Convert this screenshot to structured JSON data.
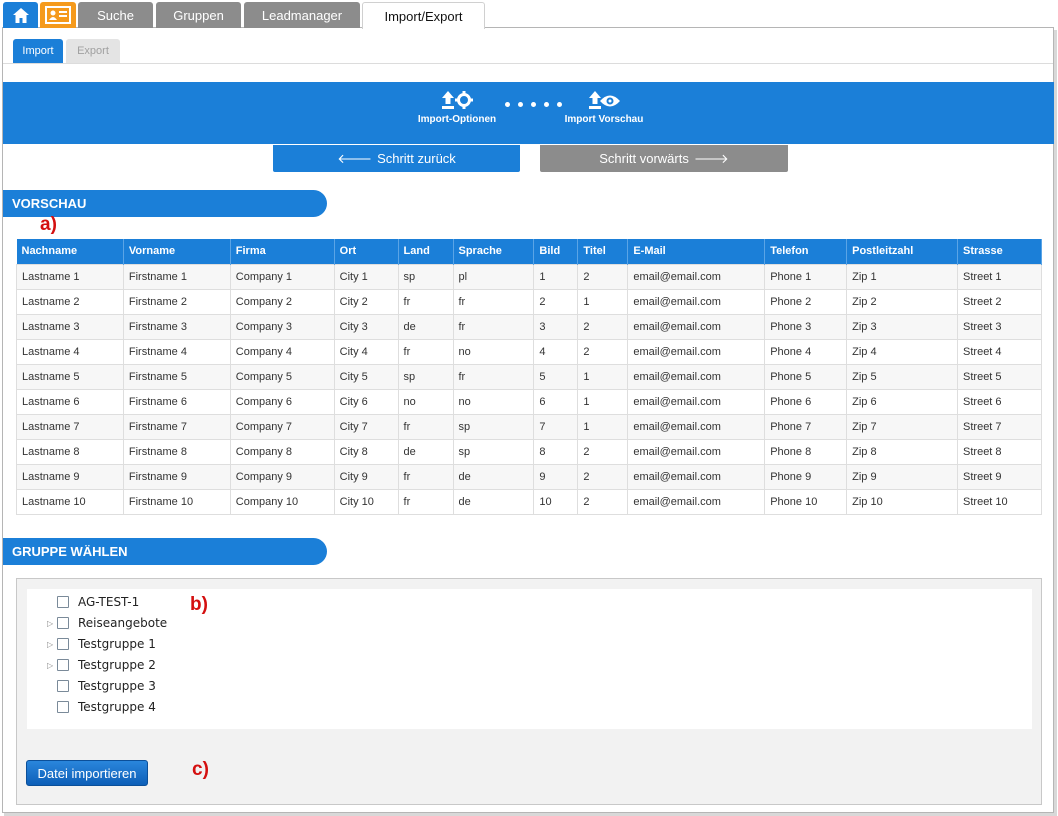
{
  "top_tabs": [
    {
      "label": "Suche",
      "active": false
    },
    {
      "label": "Gruppen",
      "active": false
    },
    {
      "label": "Leadmanager",
      "active": false
    },
    {
      "label": "Import/Export",
      "active": true
    }
  ],
  "sub_tabs": {
    "import": "Import",
    "export": "Export"
  },
  "steps": {
    "import_options": "Import-Optionen",
    "import_preview": "Import Vorschau"
  },
  "nav": {
    "back": "Schritt zurück",
    "forward": "Schritt vorwärts"
  },
  "preview": {
    "title": "VORSCHAU",
    "columns": [
      "Nachname",
      "Vorname",
      "Firma",
      "Ort",
      "Land",
      "Sprache",
      "Bild",
      "Titel",
      "E-Mail",
      "Telefon",
      "Postleitzahl",
      "Strasse"
    ],
    "rows": [
      [
        "Lastname 1",
        "Firstname 1",
        "Company 1",
        "City 1",
        "sp",
        "pl",
        "1",
        "2",
        "email@email.com",
        "Phone 1",
        "Zip 1",
        "Street 1"
      ],
      [
        "Lastname 2",
        "Firstname 2",
        "Company 2",
        "City 2",
        "fr",
        "fr",
        "2",
        "1",
        "email@email.com",
        "Phone 2",
        "Zip 2",
        "Street 2"
      ],
      [
        "Lastname 3",
        "Firstname 3",
        "Company 3",
        "City 3",
        "de",
        "fr",
        "3",
        "2",
        "email@email.com",
        "Phone 3",
        "Zip 3",
        "Street 3"
      ],
      [
        "Lastname 4",
        "Firstname 4",
        "Company 4",
        "City 4",
        "fr",
        "no",
        "4",
        "2",
        "email@email.com",
        "Phone 4",
        "Zip 4",
        "Street 4"
      ],
      [
        "Lastname 5",
        "Firstname 5",
        "Company 5",
        "City 5",
        "sp",
        "fr",
        "5",
        "1",
        "email@email.com",
        "Phone 5",
        "Zip 5",
        "Street 5"
      ],
      [
        "Lastname 6",
        "Firstname 6",
        "Company 6",
        "City 6",
        "no",
        "no",
        "6",
        "1",
        "email@email.com",
        "Phone 6",
        "Zip 6",
        "Street 6"
      ],
      [
        "Lastname 7",
        "Firstname 7",
        "Company 7",
        "City 7",
        "fr",
        "sp",
        "7",
        "1",
        "email@email.com",
        "Phone 7",
        "Zip 7",
        "Street 7"
      ],
      [
        "Lastname 8",
        "Firstname 8",
        "Company 8",
        "City 8",
        "de",
        "sp",
        "8",
        "2",
        "email@email.com",
        "Phone 8",
        "Zip 8",
        "Street 8"
      ],
      [
        "Lastname 9",
        "Firstname 9",
        "Company 9",
        "City 9",
        "fr",
        "de",
        "9",
        "2",
        "email@email.com",
        "Phone 9",
        "Zip 9",
        "Street 9"
      ],
      [
        "Lastname 10",
        "Firstname 10",
        "Company 10",
        "City 10",
        "fr",
        "de",
        "10",
        "2",
        "email@email.com",
        "Phone 10",
        "Zip 10",
        "Street 10"
      ]
    ]
  },
  "groups": {
    "title": "GRUPPE WÄHLEN",
    "items": [
      {
        "label": "AG-TEST-1",
        "expandable": false,
        "checked": false
      },
      {
        "label": "Reiseangebote",
        "expandable": true,
        "checked": false
      },
      {
        "label": "Testgruppe 1",
        "expandable": true,
        "checked": false
      },
      {
        "label": "Testgruppe 2",
        "expandable": true,
        "checked": false
      },
      {
        "label": "Testgruppe 3",
        "expandable": false,
        "checked": false
      },
      {
        "label": "Testgruppe 4",
        "expandable": false,
        "checked": false
      }
    ]
  },
  "import_button": "Datei importieren",
  "markers": {
    "a": "a)",
    "b": "b)",
    "c": "c)"
  },
  "colors": {
    "accent": "#1b7fd8",
    "inactive_tab": "#8c8c8c",
    "card_tab": "#f59a1c",
    "marker": "#d41010"
  }
}
